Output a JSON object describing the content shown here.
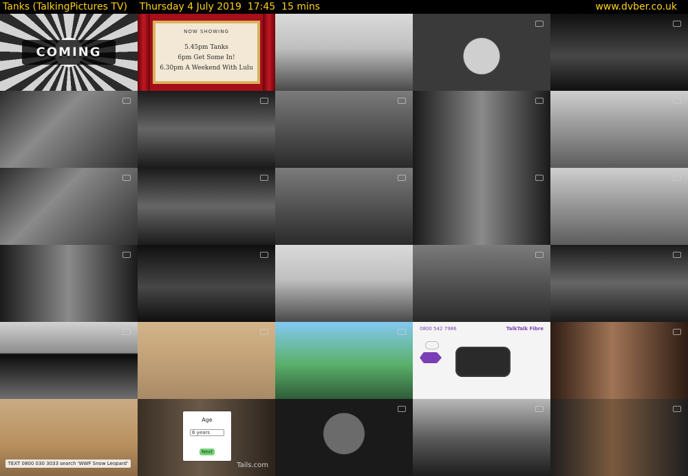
{
  "header": {
    "title": "Tanks (TalkingPictures TV)    Thursday 4 July 2019  17:45  15 mins",
    "site": "www.dvber.co.uk"
  },
  "tiles": {
    "coming": {
      "text": "COMING"
    },
    "now_showing": {
      "caption": "NOW SHOWING",
      "line1": "5.45pm Tanks",
      "line2": "6pm Get Some In!",
      "line3": "6.30pm A Weekend With Lulu"
    },
    "talktalk": {
      "phone": "0800 542 7986",
      "brand": "TalkTalk Fibre"
    },
    "tails": {
      "card_title": "Age",
      "select_value": "6 years",
      "button": "Next",
      "logo": "Tails.com"
    },
    "wwf": {
      "text": "TEXT 0800 030 3033 search 'WWF Snow Leopard'"
    }
  }
}
